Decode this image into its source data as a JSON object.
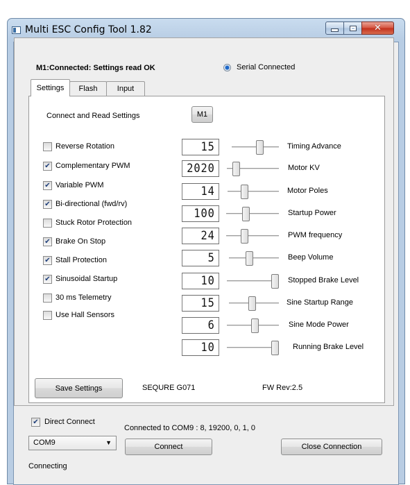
{
  "window": {
    "title": "Multi ESC Config Tool 1.82"
  },
  "status": {
    "text": "M1:Connected: Settings read OK",
    "serial_label": "Serial Connected",
    "serial_selected": true
  },
  "tabs": [
    {
      "label": "Settings",
      "active": true
    },
    {
      "label": "Flash",
      "active": false
    },
    {
      "label": "Input",
      "active": false
    }
  ],
  "settings": {
    "connect_read_label": "Connect and Read Settings",
    "m1_button": "M1",
    "checkboxes": [
      {
        "label": "Reverse Rotation",
        "checked": false
      },
      {
        "label": "Complementary PWM",
        "checked": true
      },
      {
        "label": "Variable PWM",
        "checked": true
      },
      {
        "label": "Bi-directional (fwd/rv)",
        "checked": true
      },
      {
        "label": "Stuck Rotor Protection",
        "checked": false
      },
      {
        "label": "Brake On Stop",
        "checked": true
      },
      {
        "label": "Stall Protection",
        "checked": true
      },
      {
        "label": "Sinusoidal Startup",
        "checked": true
      },
      {
        "label": "30 ms Telemetry",
        "checked": false
      },
      {
        "label": "Use Hall Sensors",
        "checked": false
      }
    ],
    "sliders": [
      {
        "value": "15",
        "label": "Timing Advance",
        "level": 0.62
      },
      {
        "value": "2020",
        "label": "Motor KV",
        "level": 0.12
      },
      {
        "value": "14",
        "label": "Motor Poles",
        "level": 0.3
      },
      {
        "value": "100",
        "label": "Startup Power",
        "level": 0.36
      },
      {
        "value": "24",
        "label": "PWM frequency",
        "level": 0.33
      },
      {
        "value": "5",
        "label": "Beep Volume",
        "level": 0.4
      },
      {
        "value": "10",
        "label": "Stopped Brake Level",
        "level": 1.0
      },
      {
        "value": "15",
        "label": "Sine Startup Range",
        "level": 0.46
      },
      {
        "value": "6",
        "label": "Sine Mode Power",
        "level": 0.55
      },
      {
        "value": "10",
        "label": "Running Brake Level",
        "level": 1.0
      }
    ],
    "save_button": "Save Settings",
    "device_name": "SEQURE G071",
    "fw_rev": "FW Rev:2.5"
  },
  "connection": {
    "direct_connect_label": "Direct Connect",
    "direct_connect_checked": true,
    "connected_to": "Connected to COM9 : 8, 19200, 0, 1, 0",
    "port": "COM9",
    "connect_button": "Connect",
    "close_button": "Close Connection",
    "status": "Connecting"
  },
  "colors": {
    "titlebar": "#c9dcef",
    "close_button": "#d4533f",
    "checkmark": "#1f3f7a",
    "radio_dot": "#1e67c8"
  },
  "icons": {
    "app": "app-window-icon",
    "minimize": "minimize-icon",
    "maximize": "maximize-icon",
    "close": "close-icon",
    "dropdown": "chevron-down-icon"
  }
}
